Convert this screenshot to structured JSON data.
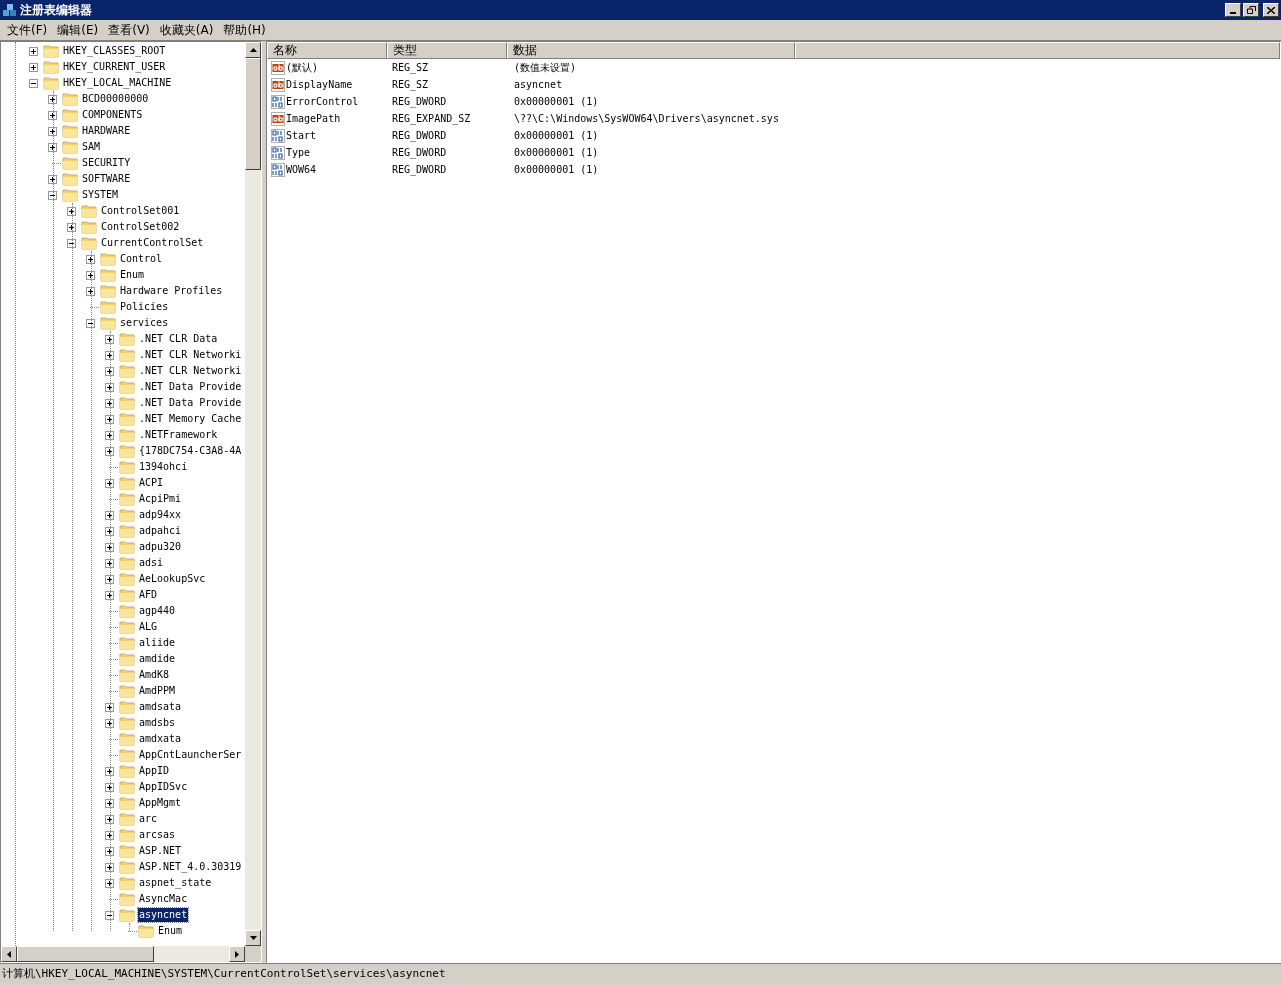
{
  "window": {
    "title": "注册表编辑器"
  },
  "menu": [
    "文件(F)",
    "编辑(E)",
    "查看(V)",
    "收藏夹(A)",
    "帮助(H)"
  ],
  "tree": [
    {
      "label": "HKEY_CLASSES_ROOT",
      "expandable": true,
      "selected": false
    },
    {
      "label": "HKEY_CURRENT_USER",
      "expandable": true,
      "selected": false
    },
    {
      "label": "HKEY_LOCAL_MACHINE",
      "expandable": true,
      "expanded": true,
      "selected": false,
      "children": [
        {
          "label": "BCD00000000",
          "expandable": true,
          "selected": false
        },
        {
          "label": "COMPONENTS",
          "expandable": true,
          "selected": false
        },
        {
          "label": "HARDWARE",
          "expandable": true,
          "selected": false
        },
        {
          "label": "SAM",
          "expandable": true,
          "selected": false
        },
        {
          "label": "SECURITY",
          "expandable": false,
          "selected": false
        },
        {
          "label": "SOFTWARE",
          "expandable": true,
          "selected": false
        },
        {
          "label": "SYSTEM",
          "expandable": true,
          "expanded": true,
          "selected": false,
          "children": [
            {
              "label": "ControlSet001",
              "expandable": true,
              "selected": false
            },
            {
              "label": "ControlSet002",
              "expandable": true,
              "selected": false
            },
            {
              "label": "CurrentControlSet",
              "expandable": true,
              "expanded": true,
              "selected": false,
              "children": [
                {
                  "label": "Control",
                  "expandable": true,
                  "selected": false
                },
                {
                  "label": "Enum",
                  "expandable": true,
                  "selected": false
                },
                {
                  "label": "Hardware Profiles",
                  "expandable": true,
                  "selected": false
                },
                {
                  "label": "Policies",
                  "expandable": false,
                  "selected": false
                },
                {
                  "label": "services",
                  "expandable": true,
                  "expanded": true,
                  "selected": false,
                  "children": [
                    {
                      "label": ".NET CLR Data",
                      "expandable": true,
                      "selected": false
                    },
                    {
                      "label": ".NET CLR Networki",
                      "expandable": true,
                      "selected": false
                    },
                    {
                      "label": ".NET CLR Networki",
                      "expandable": true,
                      "selected": false
                    },
                    {
                      "label": ".NET Data Provide",
                      "expandable": true,
                      "selected": false
                    },
                    {
                      "label": ".NET Data Provide",
                      "expandable": true,
                      "selected": false
                    },
                    {
                      "label": ".NET Memory Cache",
                      "expandable": true,
                      "selected": false
                    },
                    {
                      "label": ".NETFramework",
                      "expandable": true,
                      "selected": false
                    },
                    {
                      "label": "{178DC754-C3A8-4A",
                      "expandable": true,
                      "selected": false
                    },
                    {
                      "label": "1394ohci",
                      "expandable": false,
                      "selected": false
                    },
                    {
                      "label": "ACPI",
                      "expandable": true,
                      "selected": false
                    },
                    {
                      "label": "AcpiPmi",
                      "expandable": false,
                      "selected": false
                    },
                    {
                      "label": "adp94xx",
                      "expandable": true,
                      "selected": false
                    },
                    {
                      "label": "adpahci",
                      "expandable": true,
                      "selected": false
                    },
                    {
                      "label": "adpu320",
                      "expandable": true,
                      "selected": false
                    },
                    {
                      "label": "adsi",
                      "expandable": true,
                      "selected": false
                    },
                    {
                      "label": "AeLookupSvc",
                      "expandable": true,
                      "selected": false
                    },
                    {
                      "label": "AFD",
                      "expandable": true,
                      "selected": false
                    },
                    {
                      "label": "agp440",
                      "expandable": false,
                      "selected": false
                    },
                    {
                      "label": "ALG",
                      "expandable": false,
                      "selected": false
                    },
                    {
                      "label": "aliide",
                      "expandable": false,
                      "selected": false
                    },
                    {
                      "label": "amdide",
                      "expandable": false,
                      "selected": false
                    },
                    {
                      "label": "AmdK8",
                      "expandable": false,
                      "selected": false
                    },
                    {
                      "label": "AmdPPM",
                      "expandable": false,
                      "selected": false
                    },
                    {
                      "label": "amdsata",
                      "expandable": true,
                      "selected": false
                    },
                    {
                      "label": "amdsbs",
                      "expandable": true,
                      "selected": false
                    },
                    {
                      "label": "amdxata",
                      "expandable": false,
                      "selected": false
                    },
                    {
                      "label": "AppCntLauncherSer",
                      "expandable": false,
                      "selected": false
                    },
                    {
                      "label": "AppID",
                      "expandable": true,
                      "selected": false
                    },
                    {
                      "label": "AppIDSvc",
                      "expandable": true,
                      "selected": false
                    },
                    {
                      "label": "AppMgmt",
                      "expandable": true,
                      "selected": false
                    },
                    {
                      "label": "arc",
                      "expandable": true,
                      "selected": false
                    },
                    {
                      "label": "arcsas",
                      "expandable": true,
                      "selected": false
                    },
                    {
                      "label": "ASP.NET",
                      "expandable": true,
                      "selected": false
                    },
                    {
                      "label": "ASP.NET_4.0.30319",
                      "expandable": true,
                      "selected": false
                    },
                    {
                      "label": "aspnet_state",
                      "expandable": true,
                      "selected": false
                    },
                    {
                      "label": "AsyncMac",
                      "expandable": false,
                      "selected": false
                    },
                    {
                      "label": "asyncnet",
                      "expandable": true,
                      "expanded": true,
                      "selected": true,
                      "children": [
                        {
                          "label": "Enum",
                          "expandable": false,
                          "selected": false
                        }
                      ]
                    }
                  ]
                }
              ]
            }
          ]
        }
      ]
    }
  ],
  "columns": [
    "名称",
    "类型",
    "数据"
  ],
  "values": [
    {
      "kind": "string",
      "name": "(默认)",
      "type": "REG_SZ",
      "data": "(数值未设置)"
    },
    {
      "kind": "string",
      "name": "DisplayName",
      "type": "REG_SZ",
      "data": "asyncnet"
    },
    {
      "kind": "binary",
      "name": "ErrorControl",
      "type": "REG_DWORD",
      "data": "0x00000001 (1)"
    },
    {
      "kind": "string",
      "name": "ImagePath",
      "type": "REG_EXPAND_SZ",
      "data": "\\??\\C:\\Windows\\SysWOW64\\Drivers\\asyncnet.sys"
    },
    {
      "kind": "binary",
      "name": "Start",
      "type": "REG_DWORD",
      "data": "0x00000001 (1)"
    },
    {
      "kind": "binary",
      "name": "Type",
      "type": "REG_DWORD",
      "data": "0x00000001 (1)"
    },
    {
      "kind": "binary",
      "name": "WOW64",
      "type": "REG_DWORD",
      "data": "0x00000001 (1)"
    }
  ],
  "status_bar": "计算机\\HKEY_LOCAL_MACHINE\\SYSTEM\\CurrentControlSet\\services\\asyncnet"
}
